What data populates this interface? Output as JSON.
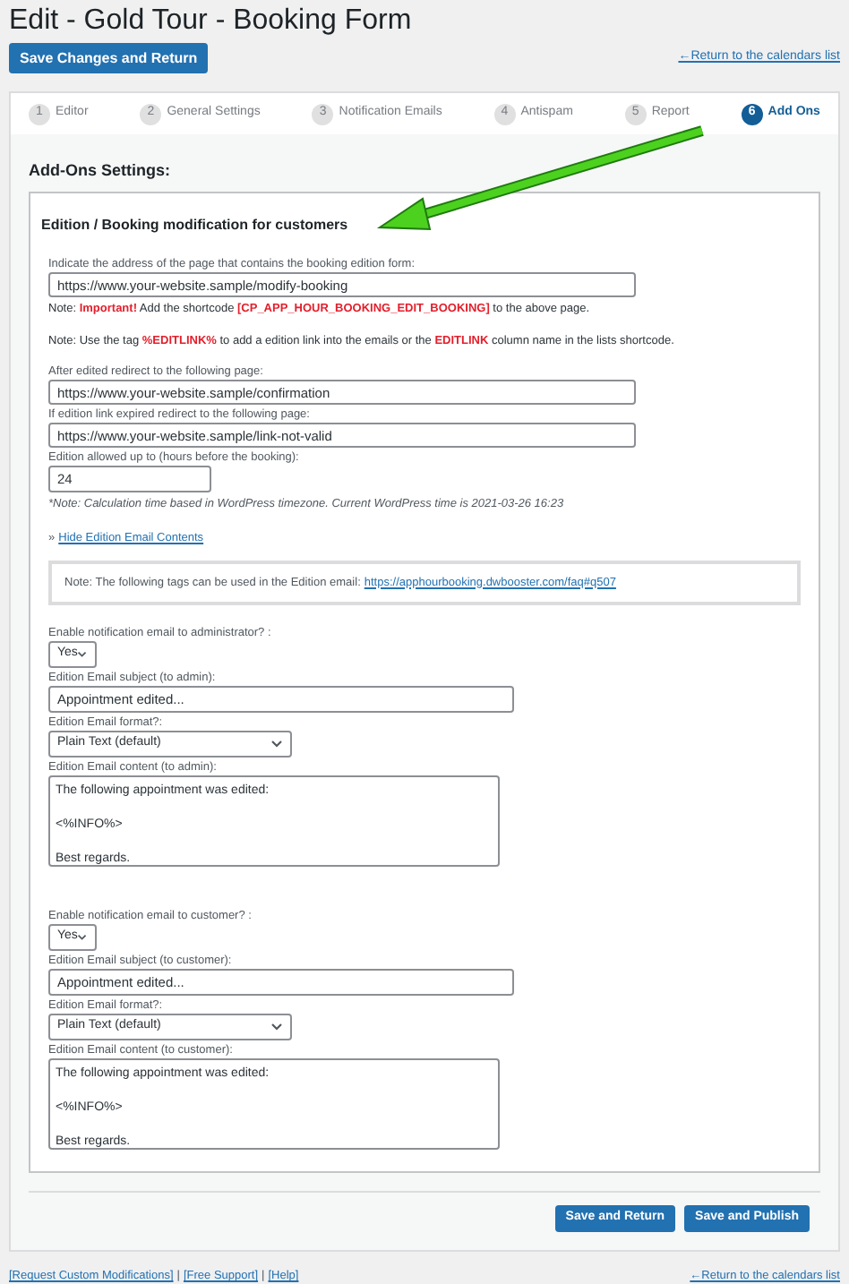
{
  "title": "Edit - Gold Tour - Booking Form",
  "save_button": "Save Changes and Return",
  "return_link": "←Return to the calendars list",
  "tabs": [
    {
      "number": "1",
      "label": "Editor",
      "selected": false
    },
    {
      "number": "2",
      "label": "General Settings",
      "selected": false
    },
    {
      "number": "3",
      "label": "Notification Emails",
      "selected": false
    },
    {
      "number": "4",
      "label": "Antispam",
      "selected": false
    },
    {
      "number": "5",
      "label": "Report",
      "selected": false
    },
    {
      "number": "6",
      "label": "Add Ons",
      "selected": true
    }
  ],
  "section_title": "Add-Ons Settings:",
  "card": {
    "title": "Edition / Booking modification for customers",
    "items": [
      {
        "kind": "label",
        "text": "Indicate the address of the page that contains the booking edition form:"
      },
      {
        "kind": "input",
        "value": "https://www.your-website.sample/modify-booking"
      },
      {
        "kind": "note",
        "segments": [
          {
            "text": "Note: ",
            "emphasis": false
          },
          {
            "text": "Important!",
            "emphasis": true
          },
          {
            "text": " Add the shortcode ",
            "emphasis": false
          },
          {
            "text": "[CP_APP_HOUR_BOOKING_EDIT_BOOKING]",
            "emphasis": true
          },
          {
            "text": " to the above page.",
            "emphasis": false
          }
        ]
      },
      {
        "kind": "note",
        "segments": [
          {
            "text": "Note: Use the tag ",
            "emphasis": false
          },
          {
            "text": "%EDITLINK%",
            "emphasis": true
          },
          {
            "text": " to add a edition link into the emails or the ",
            "emphasis": false
          },
          {
            "text": "EDITLINK",
            "emphasis": true
          },
          {
            "text": " column name in the lists shortcode.",
            "emphasis": false
          }
        ]
      },
      {
        "kind": "label",
        "text": "After edited redirect to the following page:"
      },
      {
        "kind": "input",
        "value": "https://www.your-website.sample/confirmation"
      },
      {
        "kind": "label",
        "text": "If edition link expired redirect to the following page:"
      },
      {
        "kind": "input",
        "value": "https://www.your-website.sample/link-not-valid"
      },
      {
        "kind": "label",
        "text": "Edition allowed up to (hours before the booking):"
      },
      {
        "kind": "short_input",
        "value": "24"
      },
      {
        "kind": "hint",
        "text": "*Note: Calculation time based in WordPress timezone. Current WordPress time is 2021-03-26 16:23"
      },
      {
        "kind": "link",
        "prefix": "»",
        "text": "Hide Edition Email Contents"
      },
      {
        "kind": "notebox",
        "text": "Note: The following tags can be used in the Edition email:",
        "link": "https://apphourbooking.dwbooster.com/faq#q507"
      },
      {
        "kind": "label",
        "text": "Enable notification email to administrator? :"
      },
      {
        "kind": "yesno",
        "value": "Yes"
      },
      {
        "kind": "label",
        "text": "Edition Email subject (to admin):"
      },
      {
        "kind": "medium_input",
        "value": "Appointment edited..."
      },
      {
        "kind": "label",
        "text": "Edition Email format?:"
      },
      {
        "kind": "select",
        "value": "Plain Text (default)"
      },
      {
        "kind": "label",
        "text": "Edition Email content (to admin):"
      },
      {
        "kind": "textarea",
        "value": "The following appointment was edited:\n\n<%INFO%>\n\nBest regards."
      },
      {
        "kind": "spacer"
      },
      {
        "kind": "label",
        "text": "Enable notification email to customer? :"
      },
      {
        "kind": "yesno",
        "value": "Yes"
      },
      {
        "kind": "label",
        "text": "Edition Email subject (to customer):"
      },
      {
        "kind": "medium_input",
        "value": "Appointment edited..."
      },
      {
        "kind": "label",
        "text": "Edition Email format?:"
      },
      {
        "kind": "select",
        "value": "Plain Text (default)"
      },
      {
        "kind": "label",
        "text": "Edition Email content (to customer):"
      },
      {
        "kind": "textarea",
        "value": "The following appointment was edited:\n\n<%INFO%>\n\nBest regards."
      }
    ]
  },
  "buttons": [
    "Save and Return",
    "Save and Publish"
  ],
  "footer_links": [
    "[Request Custom Modifications]",
    "[Free Support]",
    "[Help]"
  ],
  "footer_separator": "|",
  "footer_return_link": "←Return to the calendars list"
}
